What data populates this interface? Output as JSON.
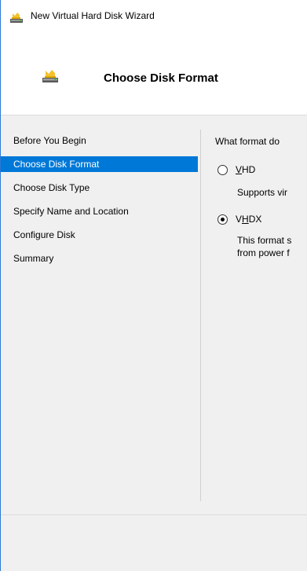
{
  "window": {
    "title": "New Virtual Hard Disk Wizard"
  },
  "header": {
    "page_title": "Choose Disk Format"
  },
  "steps": [
    {
      "label": "Before You Begin",
      "selected": false
    },
    {
      "label": "Choose Disk Format",
      "selected": true
    },
    {
      "label": "Choose Disk Type",
      "selected": false
    },
    {
      "label": "Specify Name and Location",
      "selected": false
    },
    {
      "label": "Configure Disk",
      "selected": false
    },
    {
      "label": "Summary",
      "selected": false
    }
  ],
  "content": {
    "question": "What format do",
    "options": [
      {
        "label": "VHD",
        "access_key": "V",
        "label_rest": "HD",
        "checked": false,
        "description_lines": [
          "Supports vir"
        ]
      },
      {
        "label": "VHDX",
        "label_pre": "V",
        "access_key": "H",
        "label_rest": "DX",
        "checked": true,
        "description_lines": [
          "This format s",
          "from power f"
        ]
      }
    ]
  },
  "colors": {
    "selection": "#0078d7",
    "body_background": "#f0f0f0",
    "window_border": "#2b79d6"
  },
  "icons": {
    "app": "virtual-disk-icon",
    "header": "virtual-disk-icon"
  }
}
